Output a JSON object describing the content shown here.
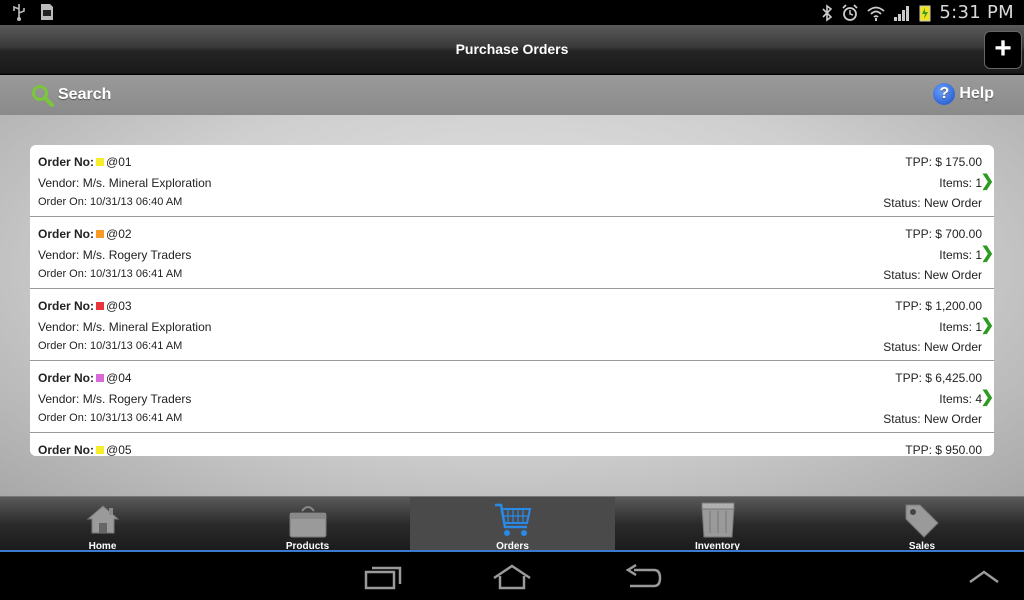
{
  "status_bar": {
    "time": "5:31 PM",
    "left_icons": [
      "usb-icon",
      "sd-card-icon"
    ],
    "right_icons": [
      "bluetooth-icon",
      "alarm-icon",
      "wifi-icon",
      "signal-icon",
      "battery-icon"
    ]
  },
  "header": {
    "title": "Purchase Orders",
    "add_label": "+"
  },
  "toolbar": {
    "search_label": "Search",
    "help_label": "Help",
    "help_glyph": "?"
  },
  "orders": [
    {
      "order_no_label": "Order No:",
      "number": "@01",
      "marker_color": "#f7ec2a",
      "vendor_label": "Vendor:",
      "vendor": "M/s. Mineral Exploration",
      "date_label": "Order On:",
      "date": "10/31/13 06:40 AM",
      "tpp_label": "TPP:",
      "tpp": "$  175.00",
      "items_label": "Items:",
      "items": "1",
      "status_label": "Status:",
      "status": "New Order"
    },
    {
      "order_no_label": "Order No:",
      "number": "@02",
      "marker_color": "#f79a26",
      "vendor_label": "Vendor:",
      "vendor": "M/s. Rogery Traders",
      "date_label": "Order On:",
      "date": "10/31/13 06:41 AM",
      "tpp_label": "TPP:",
      "tpp": "$  700.00",
      "items_label": "Items:",
      "items": "1",
      "status_label": "Status:",
      "status": "New Order"
    },
    {
      "order_no_label": "Order No:",
      "number": "@03",
      "marker_color": "#e8343c",
      "vendor_label": "Vendor:",
      "vendor": "M/s. Mineral Exploration",
      "date_label": "Order On:",
      "date": "10/31/13 06:41 AM",
      "tpp_label": "TPP:",
      "tpp": "$  1,200.00",
      "items_label": "Items:",
      "items": "1",
      "status_label": "Status:",
      "status": "New Order"
    },
    {
      "order_no_label": "Order No:",
      "number": "@04",
      "marker_color": "#d86ad8",
      "vendor_label": "Vendor:",
      "vendor": "M/s. Rogery Traders",
      "date_label": "Order On:",
      "date": "10/31/13 06:41 AM",
      "tpp_label": "TPP:",
      "tpp": "$  6,425.00",
      "items_label": "Items:",
      "items": "4",
      "status_label": "Status:",
      "status": "New Order"
    },
    {
      "order_no_label": "Order No:",
      "number": "@05",
      "marker_color": "#f7ec2a",
      "vendor_label": "",
      "vendor": "",
      "date_label": "",
      "date": "",
      "tpp_label": "TPP:",
      "tpp": "$  950.00",
      "items_label": "",
      "items": "",
      "status_label": "",
      "status": ""
    }
  ],
  "tabs": [
    {
      "label": "Home",
      "icon": "home-icon",
      "active": false
    },
    {
      "label": "Products",
      "icon": "products-box-icon",
      "active": false
    },
    {
      "label": "Orders",
      "icon": "shopping-cart-icon",
      "active": true
    },
    {
      "label": "Inventory",
      "icon": "inventory-bin-icon",
      "active": false
    },
    {
      "label": "Sales",
      "icon": "price-tag-icon",
      "active": false
    }
  ],
  "nav_buttons": [
    "recent-apps-icon",
    "home-nav-icon",
    "back-icon",
    "chevron-up-icon"
  ],
  "colors": {
    "chevron": "#2d9b1f",
    "active_tab_underline": "#3a7ad0",
    "search_icon": "#7ac83a"
  }
}
